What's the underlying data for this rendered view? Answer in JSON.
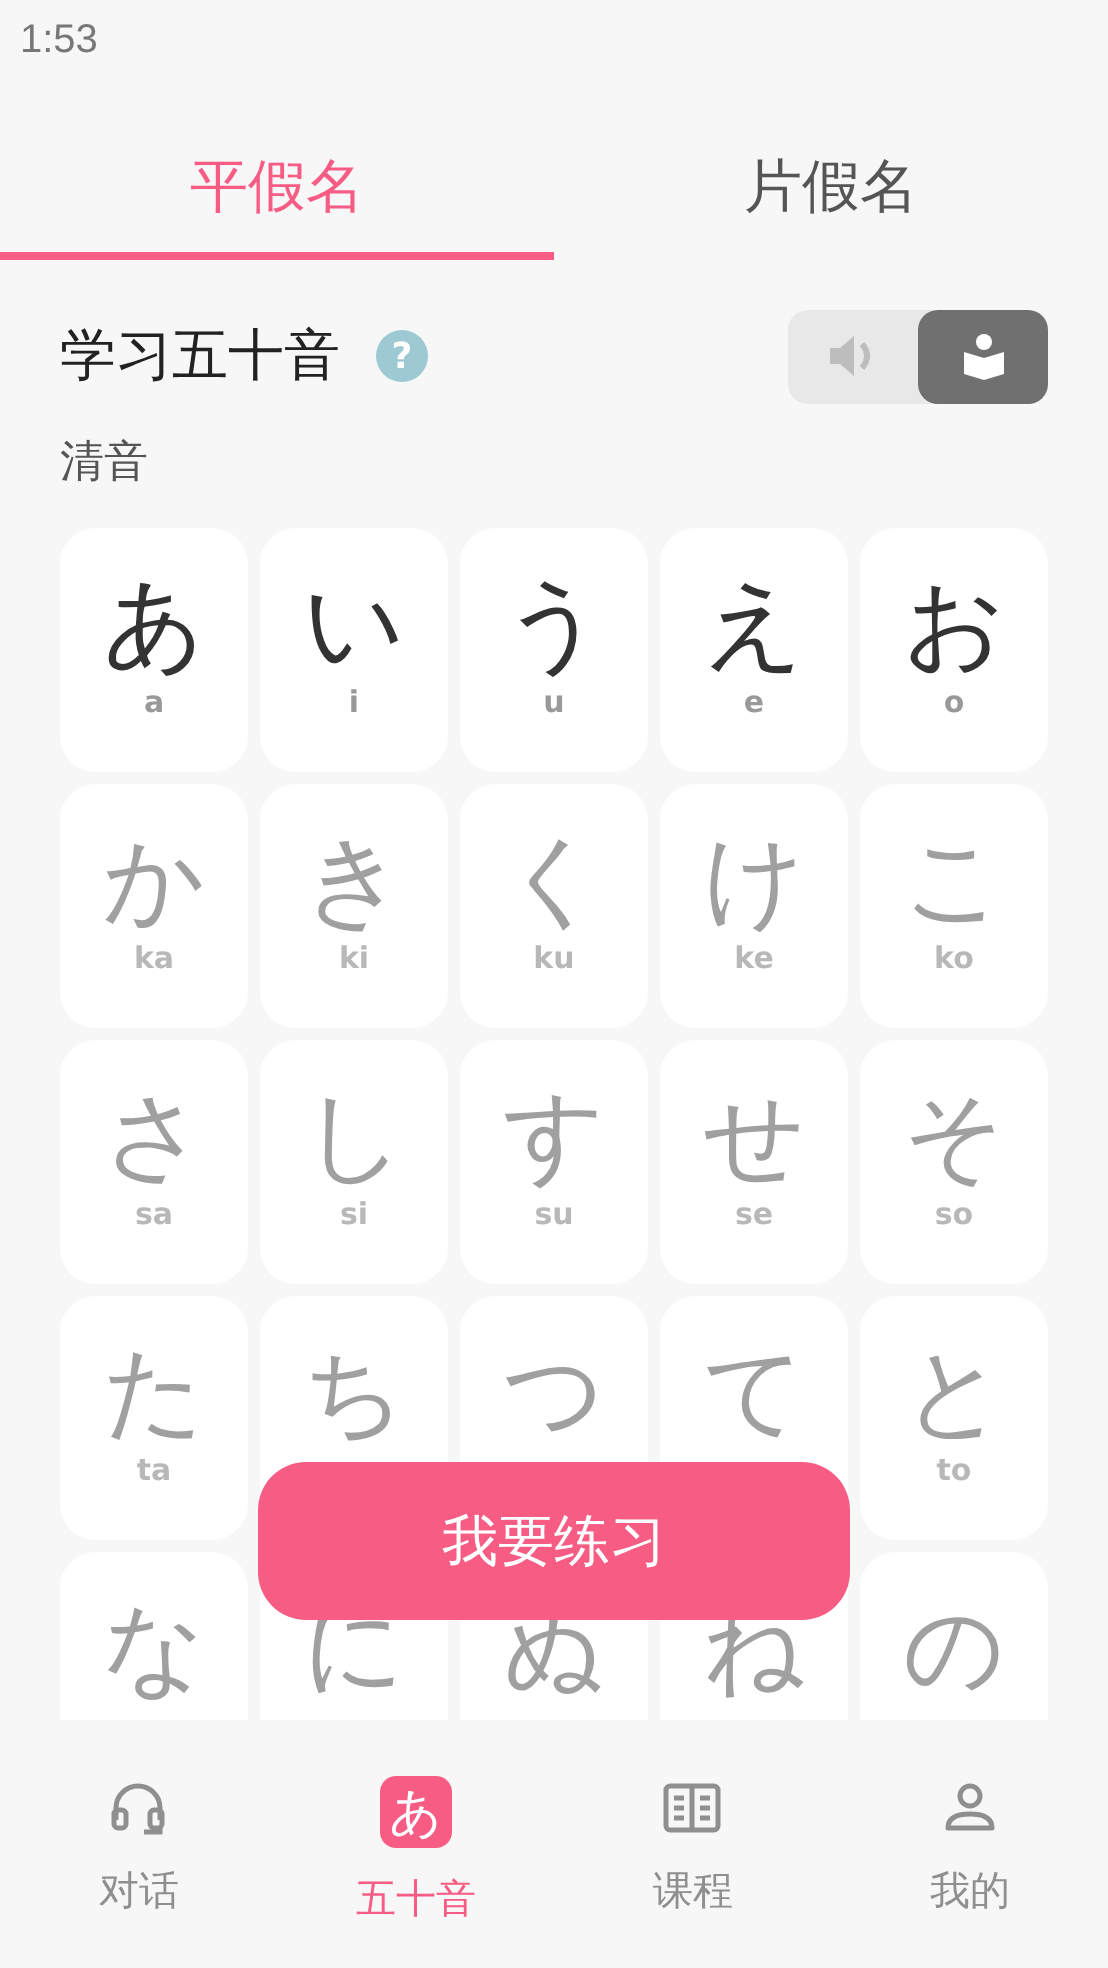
{
  "status_bar": {
    "time": "1:53"
  },
  "tabs": [
    {
      "label": "平假名",
      "selected": true
    },
    {
      "label": "片假名",
      "selected": false
    }
  ],
  "header": {
    "title": "学习五十音",
    "help": "?",
    "modes": [
      {
        "kind": "sound",
        "selected": false
      },
      {
        "kind": "read",
        "selected": true
      }
    ]
  },
  "section": "清音",
  "rows": [
    [
      {
        "kana": "あ",
        "romaji": "a",
        "learned": true
      },
      {
        "kana": "い",
        "romaji": "i",
        "learned": true
      },
      {
        "kana": "う",
        "romaji": "u",
        "learned": true
      },
      {
        "kana": "え",
        "romaji": "e",
        "learned": true
      },
      {
        "kana": "お",
        "romaji": "o",
        "learned": true
      }
    ],
    [
      {
        "kana": "か",
        "romaji": "ka",
        "learned": false
      },
      {
        "kana": "き",
        "romaji": "ki",
        "learned": false
      },
      {
        "kana": "く",
        "romaji": "ku",
        "learned": false
      },
      {
        "kana": "け",
        "romaji": "ke",
        "learned": false
      },
      {
        "kana": "こ",
        "romaji": "ko",
        "learned": false
      }
    ],
    [
      {
        "kana": "さ",
        "romaji": "sa",
        "learned": false
      },
      {
        "kana": "し",
        "romaji": "si",
        "learned": false
      },
      {
        "kana": "す",
        "romaji": "su",
        "learned": false
      },
      {
        "kana": "せ",
        "romaji": "se",
        "learned": false
      },
      {
        "kana": "そ",
        "romaji": "so",
        "learned": false
      }
    ],
    [
      {
        "kana": "た",
        "romaji": "ta",
        "learned": false
      },
      {
        "kana": "ち",
        "learned": false
      },
      {
        "kana": "つ",
        "learned": false
      },
      {
        "kana": "て",
        "learned": false
      },
      {
        "kana": "と",
        "romaji": "to",
        "learned": false
      }
    ],
    [
      {
        "kana": "な",
        "learned": false
      },
      {
        "kana": "に",
        "learned": false
      },
      {
        "kana": "ぬ",
        "learned": false
      },
      {
        "kana": "ね",
        "learned": false
      },
      {
        "kana": "の",
        "learned": false
      }
    ]
  ],
  "practice_button": "我要练习",
  "nav": [
    {
      "kind": "headset",
      "label": "对话",
      "selected": false
    },
    {
      "kind": "kana",
      "icon_text": "あ",
      "label": "五十音",
      "selected": true
    },
    {
      "kind": "book",
      "label": "课程",
      "selected": false
    },
    {
      "kind": "person",
      "label": "我的",
      "selected": false
    }
  ]
}
